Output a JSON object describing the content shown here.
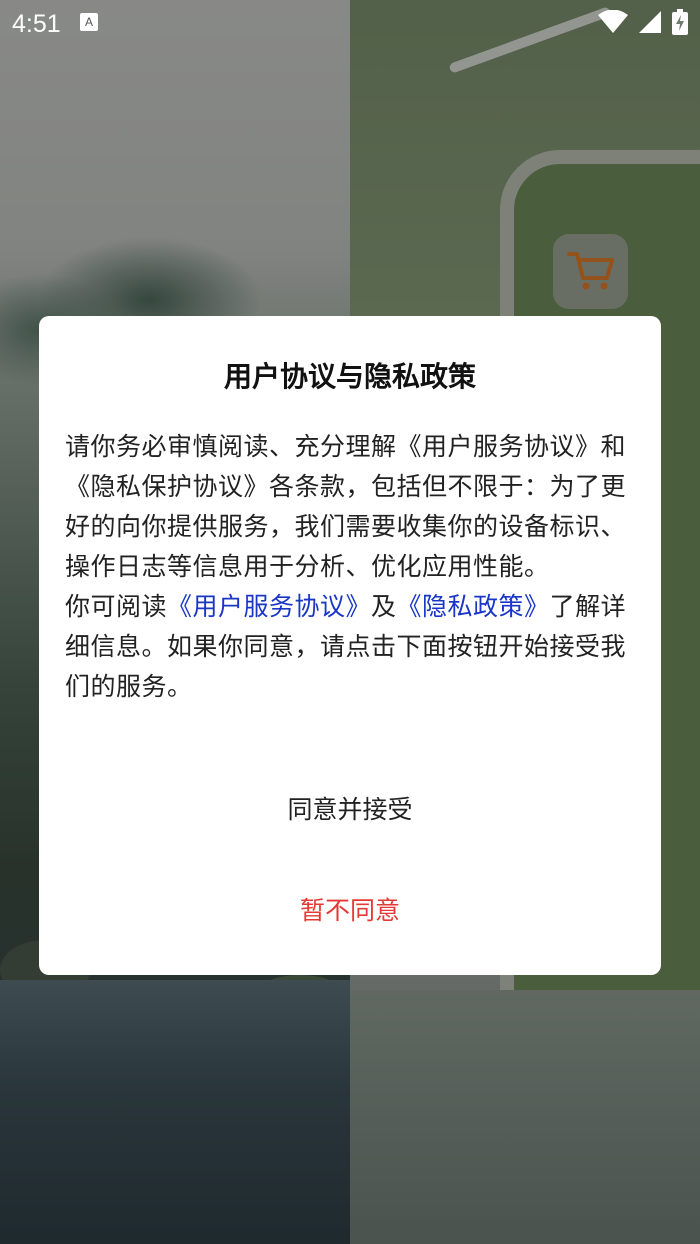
{
  "status_bar": {
    "time": "4:51",
    "notification_icon": "font-a-icon",
    "wifi_icon": "wifi-icon",
    "signal_icon": "signal-icon",
    "battery_icon": "battery-charging-icon"
  },
  "background": {
    "cart_icon": "shopping-cart-icon",
    "accent_color": "#d9792a"
  },
  "dialog": {
    "title": "用户协议与隐私政策",
    "paragraph1": "请你务必审慎阅读、充分理解《用户服务协议》和《隐私保护协议》各条款，包括但不限于：为了更好的向你提供服务，我们需要收集你的设备标识、操作日志等信息用于分析、优化应用性能。",
    "paragraph2_prefix": "你可阅读",
    "link_user_agreement": "《用户服务协议》",
    "paragraph2_join": "及",
    "link_privacy_policy": "《隐私政策》",
    "paragraph2_suffix": "了解详细信息。如果你同意，请点击下面按钮开始接受我们的服务。",
    "agree_button": "同意并接受",
    "decline_button": "暂不同意",
    "link_color": "#1a36c7",
    "decline_color": "#e53935"
  }
}
